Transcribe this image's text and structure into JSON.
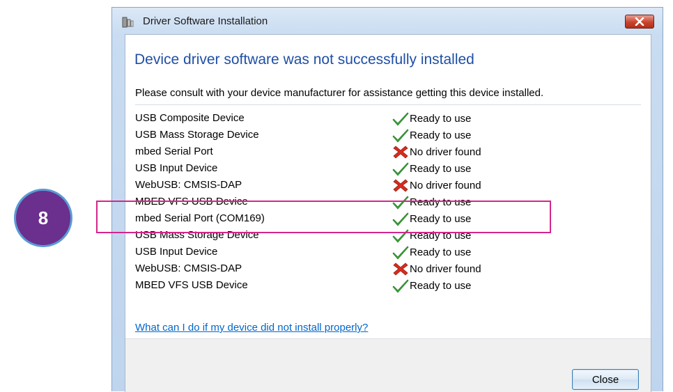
{
  "step_badge": "8",
  "window": {
    "title": "Driver Software Installation",
    "close_icon": "close-icon"
  },
  "content": {
    "heading": "Device driver software was not successfully installed",
    "instructions": "Please consult with your device manufacturer for assistance getting this device installed.",
    "devices": [
      {
        "name": "USB Composite Device",
        "status": "Ready to use",
        "icon": "checkmark-icon"
      },
      {
        "name": "USB Mass Storage Device",
        "status": "Ready to use",
        "icon": "checkmark-icon"
      },
      {
        "name": "mbed Serial Port",
        "status": "No driver found",
        "icon": "error-x-icon"
      },
      {
        "name": "USB Input Device",
        "status": "Ready to use",
        "icon": "checkmark-icon"
      },
      {
        "name": "WebUSB: CMSIS-DAP",
        "status": "No driver found",
        "icon": "error-x-icon"
      },
      {
        "name": "MBED VFS USB Device",
        "status": "Ready to use",
        "icon": "checkmark-icon"
      },
      {
        "name": "mbed Serial Port (COM169)",
        "status": "Ready to use",
        "icon": "checkmark-icon"
      },
      {
        "name": "USB Mass Storage Device",
        "status": "Ready to use",
        "icon": "checkmark-icon"
      },
      {
        "name": "USB Input Device",
        "status": "Ready to use",
        "icon": "checkmark-icon"
      },
      {
        "name": "WebUSB: CMSIS-DAP",
        "status": "No driver found",
        "icon": "error-x-icon"
      },
      {
        "name": "MBED VFS USB Device",
        "status": "Ready to use",
        "icon": "checkmark-icon"
      }
    ],
    "help_link": "What can I do if my device did not install properly?"
  },
  "footer": {
    "close_label": "Close"
  },
  "colors": {
    "heading": "#1f4fa5",
    "link": "#0066cc",
    "success": "#3aa83a",
    "error": "#d62c1e",
    "highlight": "#d4268a",
    "badge": "#6b2f8e"
  }
}
